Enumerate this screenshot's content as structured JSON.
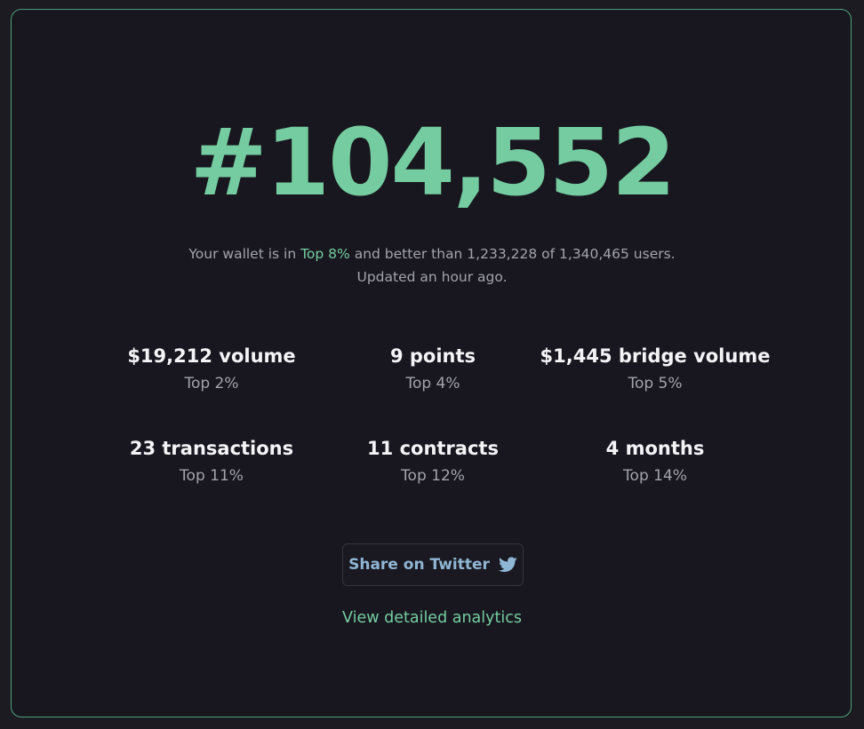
{
  "rank": "#104,552",
  "summary": {
    "line1_prefix": "Your wallet is in ",
    "line1_highlight": "Top 8%",
    "line1_suffix": " and better than 1,233,228 of 1,340,465 users.",
    "line2": "Updated an hour ago."
  },
  "stats": [
    {
      "value": "$19,212 volume",
      "percentile": "Top 2%"
    },
    {
      "value": "9 points",
      "percentile": "Top 4%"
    },
    {
      "value": "$1,445 bridge volume",
      "percentile": "Top 5%"
    },
    {
      "value": "23 transactions",
      "percentile": "Top 11%"
    },
    {
      "value": "11 contracts",
      "percentile": "Top 12%"
    },
    {
      "value": "4 months",
      "percentile": "Top 14%"
    }
  ],
  "share_button": {
    "label": "Share on Twitter",
    "icon": "twitter-icon"
  },
  "analytics_link": "View detailed analytics",
  "colors": {
    "accent": "#74cca0",
    "twitter": "#8fb6d4",
    "background": "#18171f",
    "border": "#4fa07a"
  }
}
